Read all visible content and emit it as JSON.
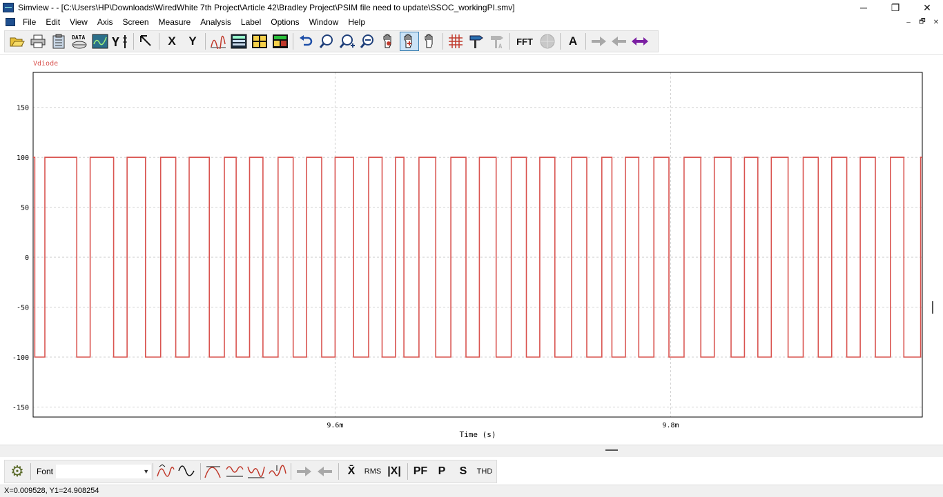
{
  "titlebar": {
    "app_name": "Simview",
    "title": "Simview -  - [C:\\Users\\HP\\Downloads\\WiredWhite 7th Project\\Article 42\\Bradley Project\\PSIM file need to update\\SSOC_workingPI.smv]",
    "minimize": "─",
    "maximize": "❐",
    "close": "✕"
  },
  "menu": {
    "items": [
      "File",
      "Edit",
      "View",
      "Axis",
      "Screen",
      "Measure",
      "Analysis",
      "Label",
      "Options",
      "Window",
      "Help"
    ],
    "mdi_minimize": "–",
    "mdi_restore": "🗗",
    "mdi_close": "✕"
  },
  "toolbar": {
    "x_label": "X",
    "y_label": "Y",
    "fft_label": "FFT",
    "text_label": "A",
    "data_label": "DATA",
    "icons": [
      "open-icon",
      "print-icon",
      "clipboard-icon",
      "data-icon",
      "scope-icon",
      "y-axis-icon",
      "cursor-icon",
      "x-axis-button",
      "y-axis-button",
      "signal-icon",
      "table-icon",
      "grid-table-icon",
      "screen-icon",
      "undo-icon",
      "zoom-icon",
      "zoom-in-icon",
      "zoom-out-icon",
      "pan-icon",
      "measure-hand-icon",
      "hand-icon",
      "grid-icon",
      "marker-icon",
      "marker-disabled-icon",
      "fft-button",
      "fft-disabled-icon",
      "text-icon",
      "arrow-right-icon",
      "arrow-left-icon",
      "arrow-both-icon"
    ]
  },
  "chart_data": {
    "type": "line",
    "series": [
      {
        "name": "Vdiode",
        "color": "#d9534f"
      }
    ],
    "title": "",
    "xlabel": "Time (s)",
    "ylabel": "",
    "x_ticks": [
      "9.6m",
      "9.8m"
    ],
    "x_tick_values": [
      0.0096,
      0.0098
    ],
    "xlim": [
      0.00942,
      0.00995
    ],
    "y_ticks": [
      150,
      100,
      50,
      0,
      -50,
      -100,
      -150
    ],
    "ylim": [
      -160,
      185
    ],
    "waveform": "square wave switching between approximately +100 and -100",
    "levels": {
      "high": 100,
      "low": -100
    },
    "transitions": [
      0.009421,
      0.009427,
      0.009446,
      0.009454,
      0.009468,
      0.009476,
      0.009487,
      0.009496,
      0.009505,
      0.009513,
      0.009525,
      0.009534,
      0.009541,
      0.009549,
      0.009557,
      0.009566,
      0.009575,
      0.009583,
      0.009592,
      0.0096,
      0.009611,
      0.00962,
      0.009628,
      0.009636,
      0.009641,
      0.00965,
      0.00966,
      0.009669,
      0.009678,
      0.009686,
      0.009696,
      0.009705,
      0.009714,
      0.009722,
      0.009731,
      0.009741,
      0.00975,
      0.009759,
      0.009765,
      0.009773,
      0.009781,
      0.00979,
      0.009799,
      0.009808,
      0.009818,
      0.009826,
      0.009836,
      0.009844,
      0.009852,
      0.00986,
      0.00987,
      0.009879,
      0.009888,
      0.009896,
      0.009905,
      0.009913,
      0.009922,
      0.009931,
      0.009939,
      0.009949
    ],
    "grid": true,
    "grid_style": "dashed"
  },
  "bottom_toolbar": {
    "font_label": "Font",
    "font_value": "",
    "rms_label": "RMS",
    "pf_label": "PF",
    "p_label": "P",
    "s_label": "S",
    "thd_label": "THD",
    "mean_label": "X̄",
    "abs_label": "|X|"
  },
  "status": {
    "text": "X=0.009528, Y1=24.908254"
  }
}
